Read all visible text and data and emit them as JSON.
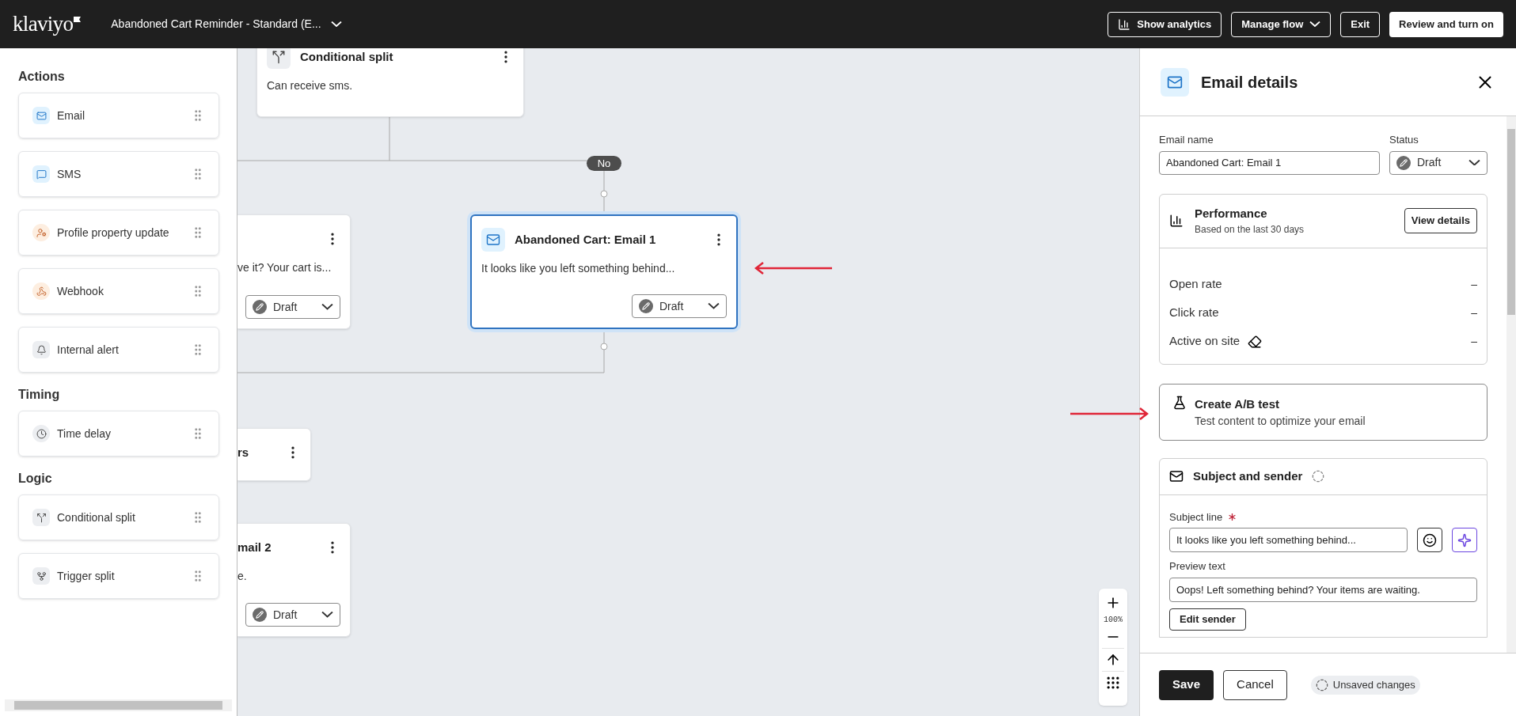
{
  "header": {
    "logo": "klaviyo",
    "flow_title": "Abandoned Cart Reminder - Standard (E...",
    "buttons": [
      {
        "label": "Show analytics",
        "kind": "analytics"
      },
      {
        "label": "Manage flow",
        "kind": "menu"
      },
      {
        "label": "Exit",
        "kind": "plain"
      },
      {
        "label": "Review and turn on",
        "kind": "primary"
      }
    ]
  },
  "sidebar": {
    "sections": [
      {
        "title": "Actions",
        "items": [
          {
            "label": "Email",
            "kind": "email"
          },
          {
            "label": "SMS",
            "kind": "sms"
          },
          {
            "label": "Profile property update",
            "kind": "profile"
          },
          {
            "label": "Webhook",
            "kind": "webhook"
          },
          {
            "label": "Internal alert",
            "kind": "alert"
          }
        ]
      },
      {
        "title": "Timing",
        "items": [
          {
            "label": "Time delay",
            "kind": "delay"
          }
        ]
      },
      {
        "title": "Logic",
        "items": [
          {
            "label": "Conditional split",
            "kind": "conditional"
          },
          {
            "label": "Trigger split",
            "kind": "trigger"
          }
        ]
      }
    ]
  },
  "canvas": {
    "branch_label": "No",
    "zoom": "100%",
    "nodes": [
      {
        "kind": "split",
        "title": "Conditional split",
        "body": "Can receive sms.",
        "selected": false
      },
      {
        "body": "ve it? Your cart is...",
        "status": "Draft",
        "selected": false
      },
      {
        "kind": "email",
        "title": "Abandoned Cart: Email 1",
        "body": "It looks like you left something behind...",
        "status": "Draft",
        "selected": true
      },
      {
        "title": "rs",
        "selected": false
      },
      {
        "title": "mail 2",
        "body": "e.",
        "status": "Draft",
        "selected": false
      }
    ]
  },
  "details_panel": {
    "title": "Email details",
    "email_name": {
      "label": "Email name",
      "value": "Abandoned Cart: Email 1"
    },
    "status": {
      "label": "Status",
      "value": "Draft"
    },
    "performance": {
      "title": "Performance",
      "subtitle": "Based on the last 30 days",
      "button": "View details",
      "metrics": [
        {
          "label": "Open rate",
          "value": "–",
          "kind": "plain"
        },
        {
          "label": "Click rate",
          "value": "–",
          "kind": "plain"
        },
        {
          "label": "Active on site",
          "value": "–",
          "kind": "editable"
        }
      ]
    },
    "ab_test": {
      "title": "Create A/B test",
      "subtitle": "Test content to optimize your email"
    },
    "subject_sender": {
      "title": "Subject and sender",
      "subject": {
        "label": "Subject line",
        "required": true,
        "value": "It looks like you left something behind..."
      },
      "preview": {
        "label": "Preview text",
        "value": "Oops! Left something behind? Your items are waiting."
      },
      "edit_button": "Edit sender"
    },
    "footer": {
      "save": "Save",
      "cancel": "Cancel",
      "status": "Unsaved changes"
    }
  }
}
